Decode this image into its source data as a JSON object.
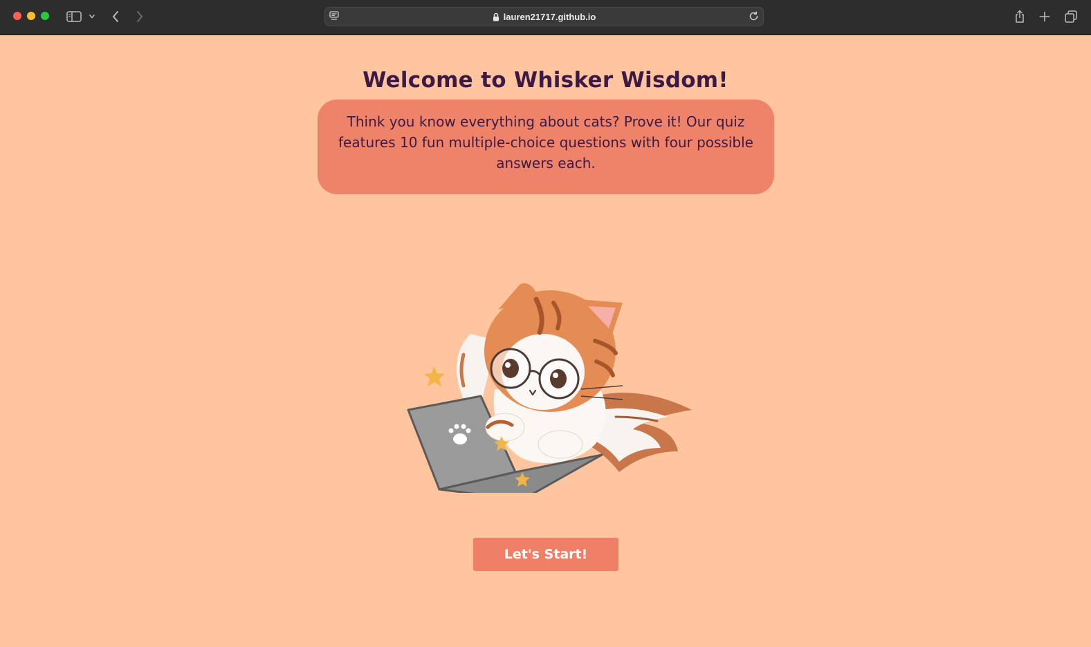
{
  "browser": {
    "url": "lauren21717.github.io",
    "icons": {
      "sidebar": "sidebar-icon",
      "chevron": "chevron-down-icon",
      "back": "back-arrow-icon",
      "forward": "forward-arrow-icon",
      "page_menu": "page-menu-icon",
      "lock": "lock-icon",
      "reload": "reload-icon",
      "share": "share-icon",
      "new_tab": "plus-icon",
      "tabs": "tab-overview-icon"
    }
  },
  "page": {
    "title": "Welcome to Whisker Wisdom!",
    "intro": "Think you know everything about cats? Prove it! Our quiz features 10 fun multiple-choice questions with four possible answers each.",
    "illustration": "cat-with-glasses-typing-on-laptop",
    "start_button": "Let's Start!"
  },
  "colors": {
    "background": "#ffc59f",
    "intro_box": "#ef836a",
    "button": "#ef7f66",
    "title_text": "#3d1a44",
    "button_text": "#ffffff"
  }
}
